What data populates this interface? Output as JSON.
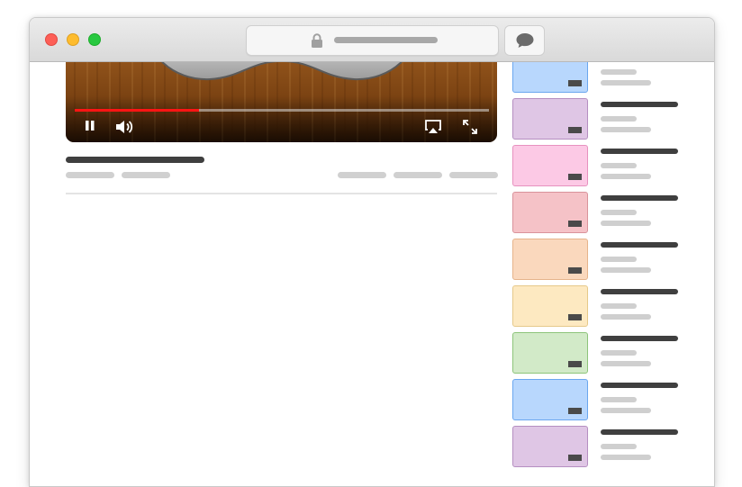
{
  "colors": {
    "progress": "#ff1414",
    "close": "#fd5f57",
    "minimize": "#febc2e",
    "maximize": "#28c840"
  },
  "player": {
    "progress_fraction": 0.3,
    "controls": [
      "pause-icon",
      "volume-icon",
      "airplay-icon",
      "fullscreen-icon"
    ]
  },
  "recommendations": [
    {
      "fill": "#b8d7fd",
      "border": "#6aa6ef"
    },
    {
      "fill": "#dfc6e5",
      "border": "#b58fc1"
    },
    {
      "fill": "#fcc9e5",
      "border": "#e792bf"
    },
    {
      "fill": "#f5c2c7",
      "border": "#d9939b"
    },
    {
      "fill": "#fad8bd",
      "border": "#e6b48b"
    },
    {
      "fill": "#fde9c1",
      "border": "#e6c98a"
    },
    {
      "fill": "#d2eac8",
      "border": "#8dc47a"
    },
    {
      "fill": "#b8d7fd",
      "border": "#6aa6ef"
    },
    {
      "fill": "#dfc6e5",
      "border": "#b58fc1"
    }
  ]
}
